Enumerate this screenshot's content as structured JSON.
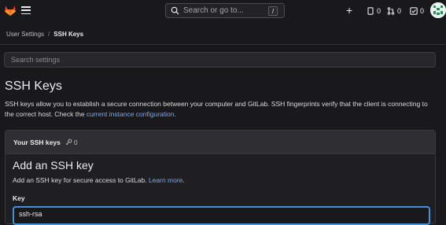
{
  "topbar": {
    "search_placeholder": "Search or go to...",
    "search_shortcut": "/",
    "issues_count": "0",
    "merge_requests_count": "0",
    "todos_count": "0"
  },
  "breadcrumb": {
    "parent": "User Settings",
    "separator": "/",
    "current": "SSH Keys"
  },
  "settings_search": {
    "placeholder": "Search settings"
  },
  "page": {
    "title": "SSH Keys",
    "description": "SSH keys allow you to establish a secure connection between your computer and GitLab. SSH fingerprints verify that the client is connecting to the correct host. Check the",
    "description_link": "current instance configuration",
    "description_end": "."
  },
  "keys_card": {
    "header_title": "Your SSH keys",
    "header_count": "0",
    "add_title": "Add an SSH key",
    "add_description": "Add an SSH key for secure access to GitLab.",
    "learn_more": "Learn more",
    "learn_more_end": ".",
    "key_label": "Key",
    "key_value": "ssh-rsa"
  },
  "colors": {
    "background": "#19191b",
    "accent_link": "#7ba8f2",
    "focus_border": "#428fdc",
    "logo": "#e24329"
  },
  "icons": [
    "gitlab-logo",
    "hamburger-icon",
    "search-icon",
    "plus-icon",
    "issues-icon",
    "merge-request-icon",
    "todo-icon",
    "avatar",
    "key-icon"
  ]
}
